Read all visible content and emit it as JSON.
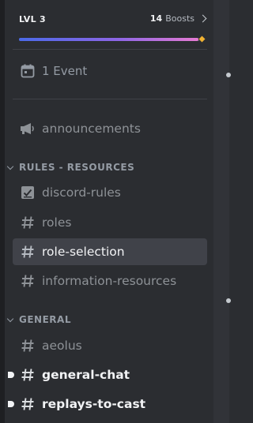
{
  "boost": {
    "level": "LVL 3",
    "count": "14",
    "count_suffix": "Boosts",
    "progress": 0.98
  },
  "events": {
    "label": "1 Event"
  },
  "channels_top": [
    {
      "name": "announcements",
      "icon": "megaphone-icon"
    }
  ],
  "categories": [
    {
      "title": "RULES - RESOURCES",
      "channels": [
        {
          "name": "discord-rules",
          "icon": "rules-checkbox-icon"
        },
        {
          "name": "roles",
          "icon": "hash-icon"
        },
        {
          "name": "role-selection",
          "icon": "hash-icon",
          "selected": true
        },
        {
          "name": "information-resources",
          "icon": "hash-icon"
        }
      ]
    },
    {
      "title": "GENERAL",
      "channels": [
        {
          "name": "aeolus",
          "icon": "hash-icon"
        },
        {
          "name": "general-chat",
          "icon": "hash-icon",
          "unread": true
        },
        {
          "name": "replays-to-cast",
          "icon": "hash-icon",
          "unread": true
        }
      ]
    }
  ]
}
